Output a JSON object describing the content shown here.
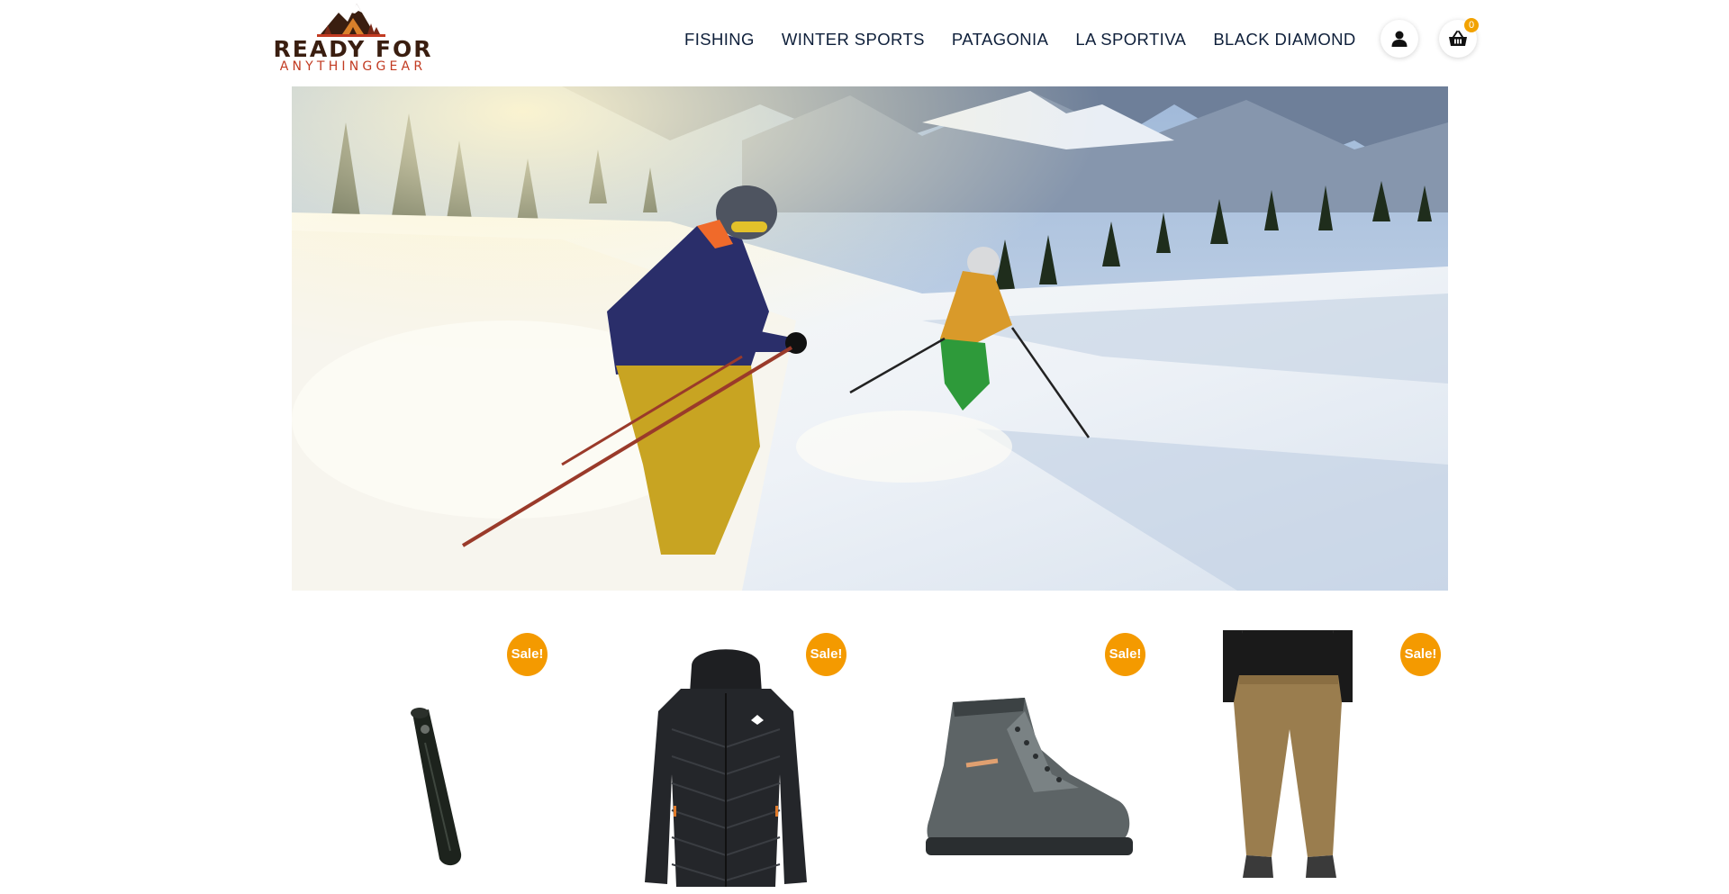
{
  "brand": {
    "name_line1": "READY FOR",
    "name_line2": "ANYTHINGGEAR"
  },
  "nav": {
    "items": [
      {
        "label": "FISHING"
      },
      {
        "label": "WINTER SPORTS"
      },
      {
        "label": "PATAGONIA"
      },
      {
        "label": "LA SPORTIVA"
      },
      {
        "label": "BLACK DIAMOND"
      }
    ]
  },
  "header_icons": {
    "account_icon": "person-icon",
    "cart_icon": "basket-icon",
    "cart_count": "0"
  },
  "colors": {
    "accent": "#f49a00",
    "nav_text": "#0e1f3a",
    "brand_dark": "#3a1e10",
    "brand_red": "#c23b22"
  },
  "products": [
    {
      "badge": "Sale!",
      "image": "ski-skins-image"
    },
    {
      "badge": "Sale!",
      "image": "black-puffer-jacket-image"
    },
    {
      "badge": "Sale!",
      "image": "grey-hiking-boot-image"
    },
    {
      "badge": "Sale!",
      "image": "tan-hiking-pants-image"
    }
  ]
}
